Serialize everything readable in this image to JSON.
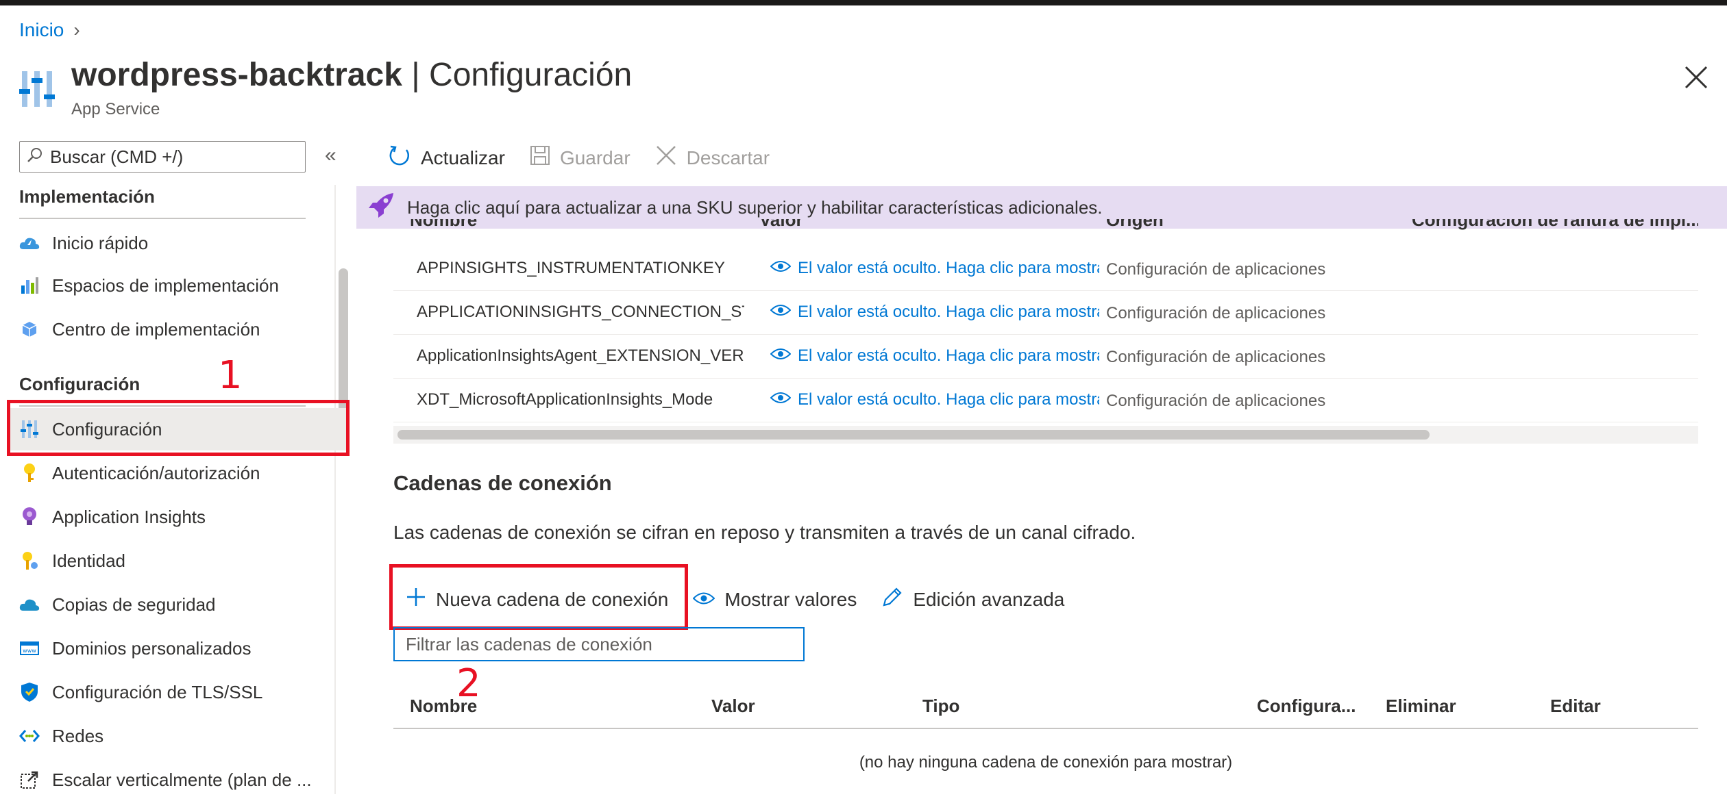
{
  "breadcrumb": {
    "home": "Inicio"
  },
  "header": {
    "resource": "wordpress-backtrack",
    "separator": " | ",
    "page": "Configuración",
    "subtitle": "App Service"
  },
  "sidebar": {
    "search_placeholder": "Buscar (CMD +/)",
    "collapse_glyph": "«",
    "groups": [
      {
        "label": "Implementación",
        "items": [
          {
            "label": "Inicio rápido",
            "icon": "quickstart-cloud-icon"
          },
          {
            "label": "Espacios de implementación",
            "icon": "deployment-slots-icon"
          },
          {
            "label": "Centro de implementación",
            "icon": "deployment-center-icon"
          }
        ]
      },
      {
        "label": "Configuración",
        "items": [
          {
            "label": "Configuración",
            "icon": "configuration-sliders-icon",
            "selected": true
          },
          {
            "label": "Autenticación/autorización",
            "icon": "key-icon"
          },
          {
            "label": "Application Insights",
            "icon": "lightbulb-icon"
          },
          {
            "label": "Identidad",
            "icon": "identity-key-icon"
          },
          {
            "label": "Copias de seguridad",
            "icon": "backup-cloud-icon"
          },
          {
            "label": "Dominios personalizados",
            "icon": "custom-domain-icon"
          },
          {
            "label": "Configuración de TLS/SSL",
            "icon": "shield-icon"
          },
          {
            "label": "Redes",
            "icon": "networking-icon"
          },
          {
            "label": "Escalar verticalmente (plan de ...",
            "icon": "scale-up-icon"
          }
        ]
      }
    ]
  },
  "annotations": {
    "step1": "1",
    "step2": "2"
  },
  "toolbar": {
    "refresh": "Actualizar",
    "save": "Guardar",
    "discard": "Descartar"
  },
  "banner": {
    "text": "Haga clic aquí para actualizar a una SKU superior y habilitar características adicionales."
  },
  "app_settings": {
    "columns": [
      "Nombre",
      "Valor",
      "Origen",
      "Configuración de ranura de impl..."
    ],
    "rows": [
      {
        "name": "APPINSIGHTS_INSTRUMENTATIONKEY",
        "value": "El valor está oculto. Haga clic para mostrar",
        "source": "Configuración de aplicaciones"
      },
      {
        "name": "APPLICATIONINSIGHTS_CONNECTION_STRING",
        "value": "El valor está oculto. Haga clic para mostrar",
        "source": "Configuración de aplicaciones"
      },
      {
        "name": "ApplicationInsightsAgent_EXTENSION_VERSION",
        "value": "El valor está oculto. Haga clic para mostrar",
        "source": "Configuración de aplicaciones"
      },
      {
        "name": "XDT_MicrosoftApplicationInsights_Mode",
        "value": "El valor está oculto. Haga clic para mostrar",
        "source": "Configuración de aplicaciones"
      }
    ]
  },
  "connection_strings": {
    "title": "Cadenas de conexión",
    "description": "Las cadenas de conexión se cifran en reposo y transmiten a través de un canal cifrado.",
    "actions": {
      "new": "Nueva cadena de conexión",
      "show": "Mostrar valores",
      "advanced": "Edición avanzada"
    },
    "filter_placeholder": "Filtrar las cadenas de conexión",
    "columns": [
      "Nombre",
      "Valor",
      "Tipo",
      "Configura...",
      "Eliminar",
      "Editar"
    ],
    "empty": "(no hay ninguna cadena de conexión para mostrar)"
  }
}
